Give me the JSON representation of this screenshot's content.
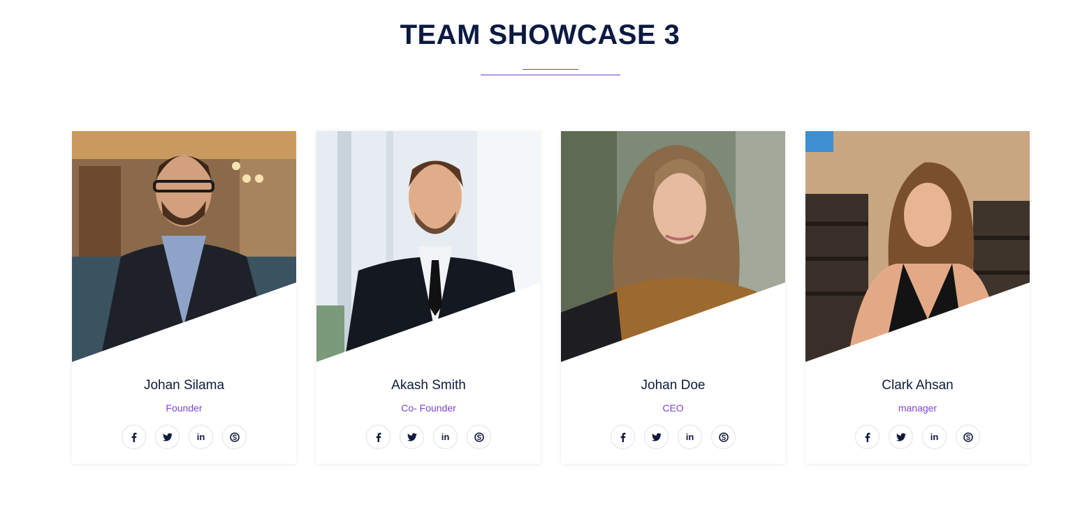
{
  "heading": {
    "title": "TEAM SHOWCASE 3"
  },
  "colors": {
    "accent": "#7b45d1",
    "text": "#0f1a3c"
  },
  "members": [
    {
      "name": "Johan Silama",
      "role": "Founder"
    },
    {
      "name": "Akash Smith",
      "role": "Co- Founder"
    },
    {
      "name": "Johan Doe",
      "role": "CEO"
    },
    {
      "name": "Clark Ahsan",
      "role": "manager"
    }
  ],
  "social": {
    "linkedin_label": "in",
    "icons": [
      "facebook-icon",
      "twitter-icon",
      "linkedin-icon",
      "skype-icon"
    ]
  }
}
